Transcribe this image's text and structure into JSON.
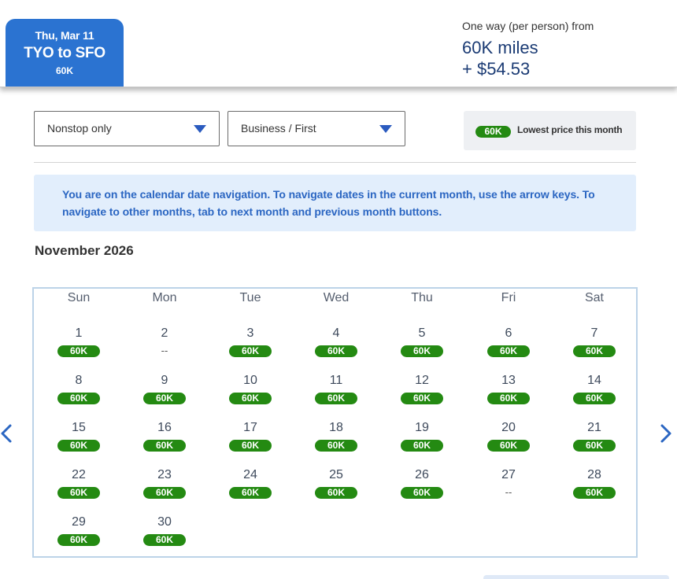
{
  "selected_tab": {
    "date": "Thu, Mar 11",
    "route": "TYO to SFO",
    "price": "60K"
  },
  "fare": {
    "label": "One way (per person) from",
    "miles": "60K miles",
    "cash": "+ $54.53"
  },
  "filters": {
    "stops": "Nonstop only",
    "cabin": "Business / First"
  },
  "legend": {
    "pill": "60K",
    "text": "Lowest price this month"
  },
  "notice": "You are on the calendar date navigation. To navigate dates in the current month, use the arrow keys. To navigate to other months, tab to next month and previous month buttons.",
  "month": "November 2026",
  "weekdays": [
    "Sun",
    "Mon",
    "Tue",
    "Wed",
    "Thu",
    "Fri",
    "Sat"
  ],
  "days": [
    {
      "day": "1",
      "price": "60K"
    },
    {
      "day": "2",
      "price": "--"
    },
    {
      "day": "3",
      "price": "60K"
    },
    {
      "day": "4",
      "price": "60K"
    },
    {
      "day": "5",
      "price": "60K"
    },
    {
      "day": "6",
      "price": "60K"
    },
    {
      "day": "7",
      "price": "60K"
    },
    {
      "day": "8",
      "price": "60K"
    },
    {
      "day": "9",
      "price": "60K"
    },
    {
      "day": "10",
      "price": "60K"
    },
    {
      "day": "11",
      "price": "60K"
    },
    {
      "day": "12",
      "price": "60K"
    },
    {
      "day": "13",
      "price": "60K"
    },
    {
      "day": "14",
      "price": "60K"
    },
    {
      "day": "15",
      "price": "60K"
    },
    {
      "day": "16",
      "price": "60K"
    },
    {
      "day": "17",
      "price": "60K"
    },
    {
      "day": "18",
      "price": "60K"
    },
    {
      "day": "19",
      "price": "60K"
    },
    {
      "day": "20",
      "price": "60K"
    },
    {
      "day": "21",
      "price": "60K"
    },
    {
      "day": "22",
      "price": "60K"
    },
    {
      "day": "23",
      "price": "60K"
    },
    {
      "day": "24",
      "price": "60K"
    },
    {
      "day": "25",
      "price": "60K"
    },
    {
      "day": "26",
      "price": "60K"
    },
    {
      "day": "27",
      "price": "--"
    },
    {
      "day": "28",
      "price": "60K"
    },
    {
      "day": "29",
      "price": "60K"
    },
    {
      "day": "30",
      "price": "60K"
    }
  ],
  "icons": {
    "prev": "chevron-left-icon",
    "next": "chevron-right-icon",
    "dropdown": "caret-down-icon"
  },
  "colors": {
    "brand_blue": "#2b73d1",
    "price_green": "#248a12",
    "notice_bg": "#e2eefc",
    "calendar_border": "#bcd3e8"
  }
}
